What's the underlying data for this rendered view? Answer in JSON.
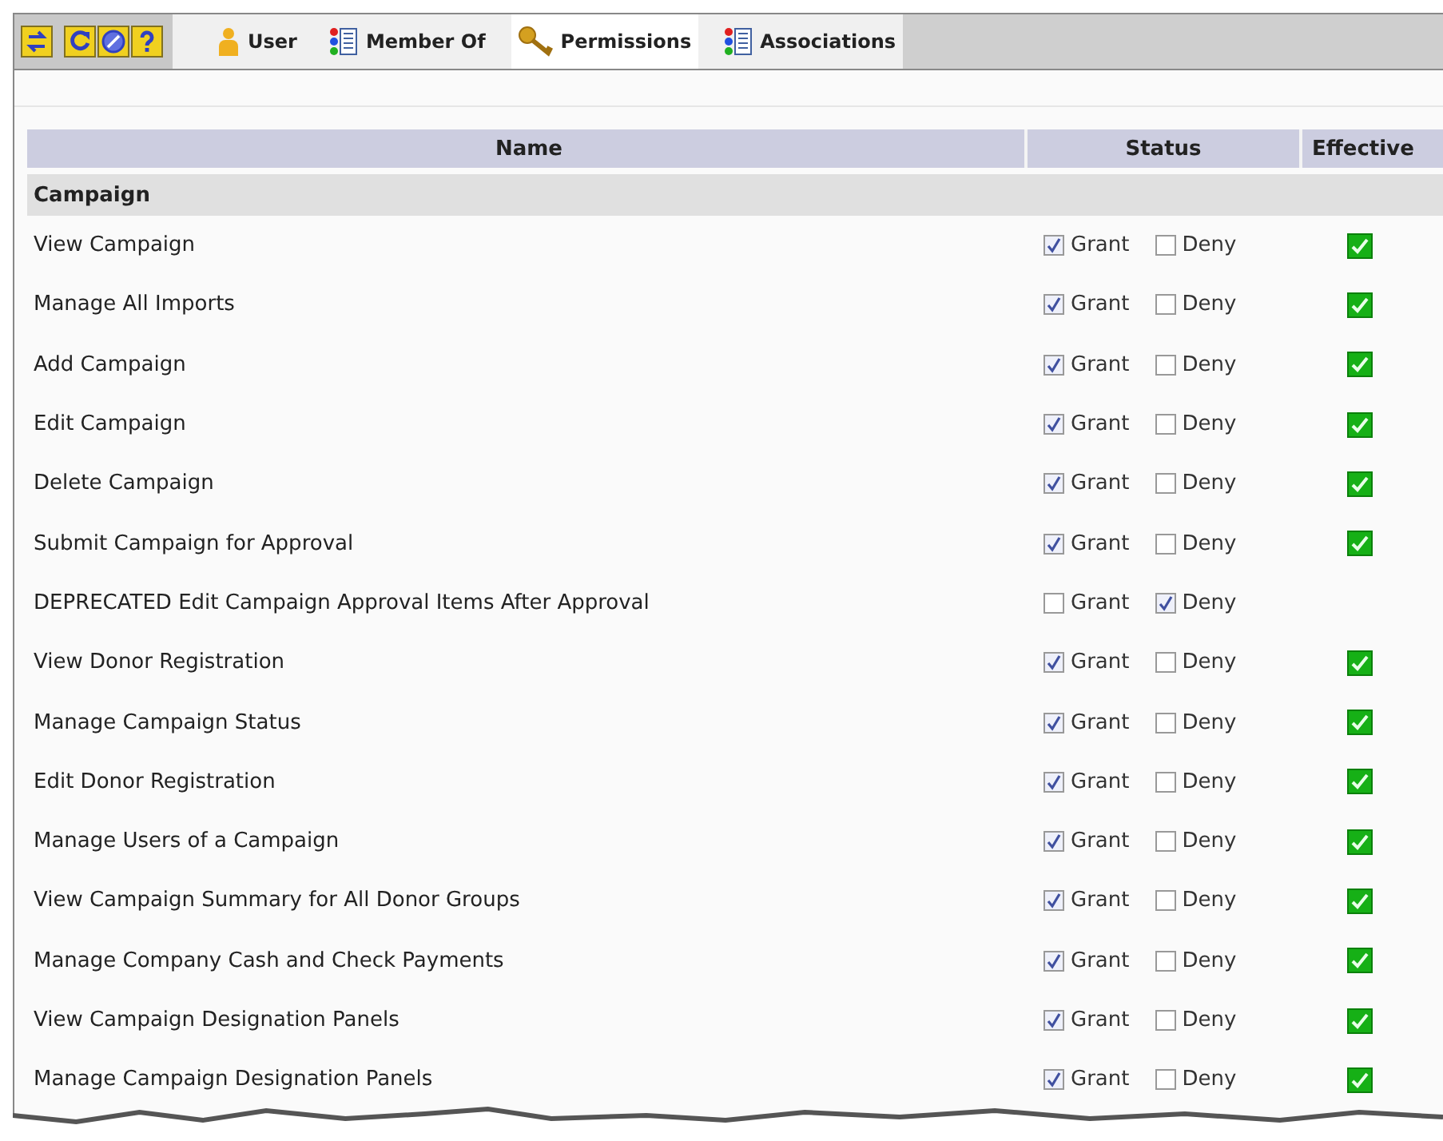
{
  "toolbar": {
    "buttons": [
      {
        "kind": "swap"
      },
      {
        "kind": "refresh"
      },
      {
        "kind": "cancel"
      },
      {
        "kind": "help"
      }
    ]
  },
  "tabs": [
    {
      "label": "User",
      "kind": "user",
      "selected": false
    },
    {
      "label": "Member Of",
      "kind": "list",
      "selected": false
    },
    {
      "label": "Permissions",
      "kind": "key",
      "selected": true
    },
    {
      "label": "Associations",
      "kind": "list",
      "selected": false
    }
  ],
  "table": {
    "columns": [
      "Name",
      "Status",
      "Effective"
    ],
    "group": "Campaign",
    "rows": [
      {
        "name": "View Campaign",
        "grant_label": "Grant",
        "grant": true,
        "deny_label": "Deny",
        "deny": false,
        "effective": true
      },
      {
        "name": "Manage All Imports",
        "grant_label": "Grant",
        "grant": true,
        "deny_label": "Deny",
        "deny": false,
        "effective": true
      },
      {
        "name": "Add Campaign",
        "grant_label": "Grant",
        "grant": true,
        "deny_label": "Deny",
        "deny": false,
        "effective": true
      },
      {
        "name": "Edit Campaign",
        "grant_label": "Grant",
        "grant": true,
        "deny_label": "Deny",
        "deny": false,
        "effective": true
      },
      {
        "name": "Delete Campaign",
        "grant_label": "Grant",
        "grant": true,
        "deny_label": "Deny",
        "deny": false,
        "effective": true
      },
      {
        "name": "Submit Campaign for Approval",
        "grant_label": "Grant",
        "grant": true,
        "deny_label": "Deny",
        "deny": false,
        "effective": true
      },
      {
        "name": "DEPRECATED Edit Campaign Approval Items After Approval",
        "grant_label": "Grant",
        "grant": false,
        "deny_label": "Deny",
        "deny": true,
        "effective": false
      },
      {
        "name": "View Donor Registration",
        "grant_label": "Grant",
        "grant": true,
        "deny_label": "Deny",
        "deny": false,
        "effective": true
      },
      {
        "name": "Manage Campaign Status",
        "grant_label": "Grant",
        "grant": true,
        "deny_label": "Deny",
        "deny": false,
        "effective": true
      },
      {
        "name": "Edit Donor Registration",
        "grant_label": "Grant",
        "grant": true,
        "deny_label": "Deny",
        "deny": false,
        "effective": true
      },
      {
        "name": "Manage Users of a Campaign",
        "grant_label": "Grant",
        "grant": true,
        "deny_label": "Deny",
        "deny": false,
        "effective": true
      },
      {
        "name": "View Campaign Summary for All Donor Groups",
        "grant_label": "Grant",
        "grant": true,
        "deny_label": "Deny",
        "deny": false,
        "effective": true
      },
      {
        "name": "Manage Company Cash and Check Payments",
        "grant_label": "Grant",
        "grant": true,
        "deny_label": "Deny",
        "deny": false,
        "effective": true
      },
      {
        "name": "View Campaign Designation Panels",
        "grant_label": "Grant",
        "grant": true,
        "deny_label": "Deny",
        "deny": false,
        "effective": true
      },
      {
        "name": "Manage Campaign Designation Panels",
        "grant_label": "Grant",
        "grant": true,
        "deny_label": "Deny",
        "deny": false,
        "effective": true
      }
    ]
  }
}
